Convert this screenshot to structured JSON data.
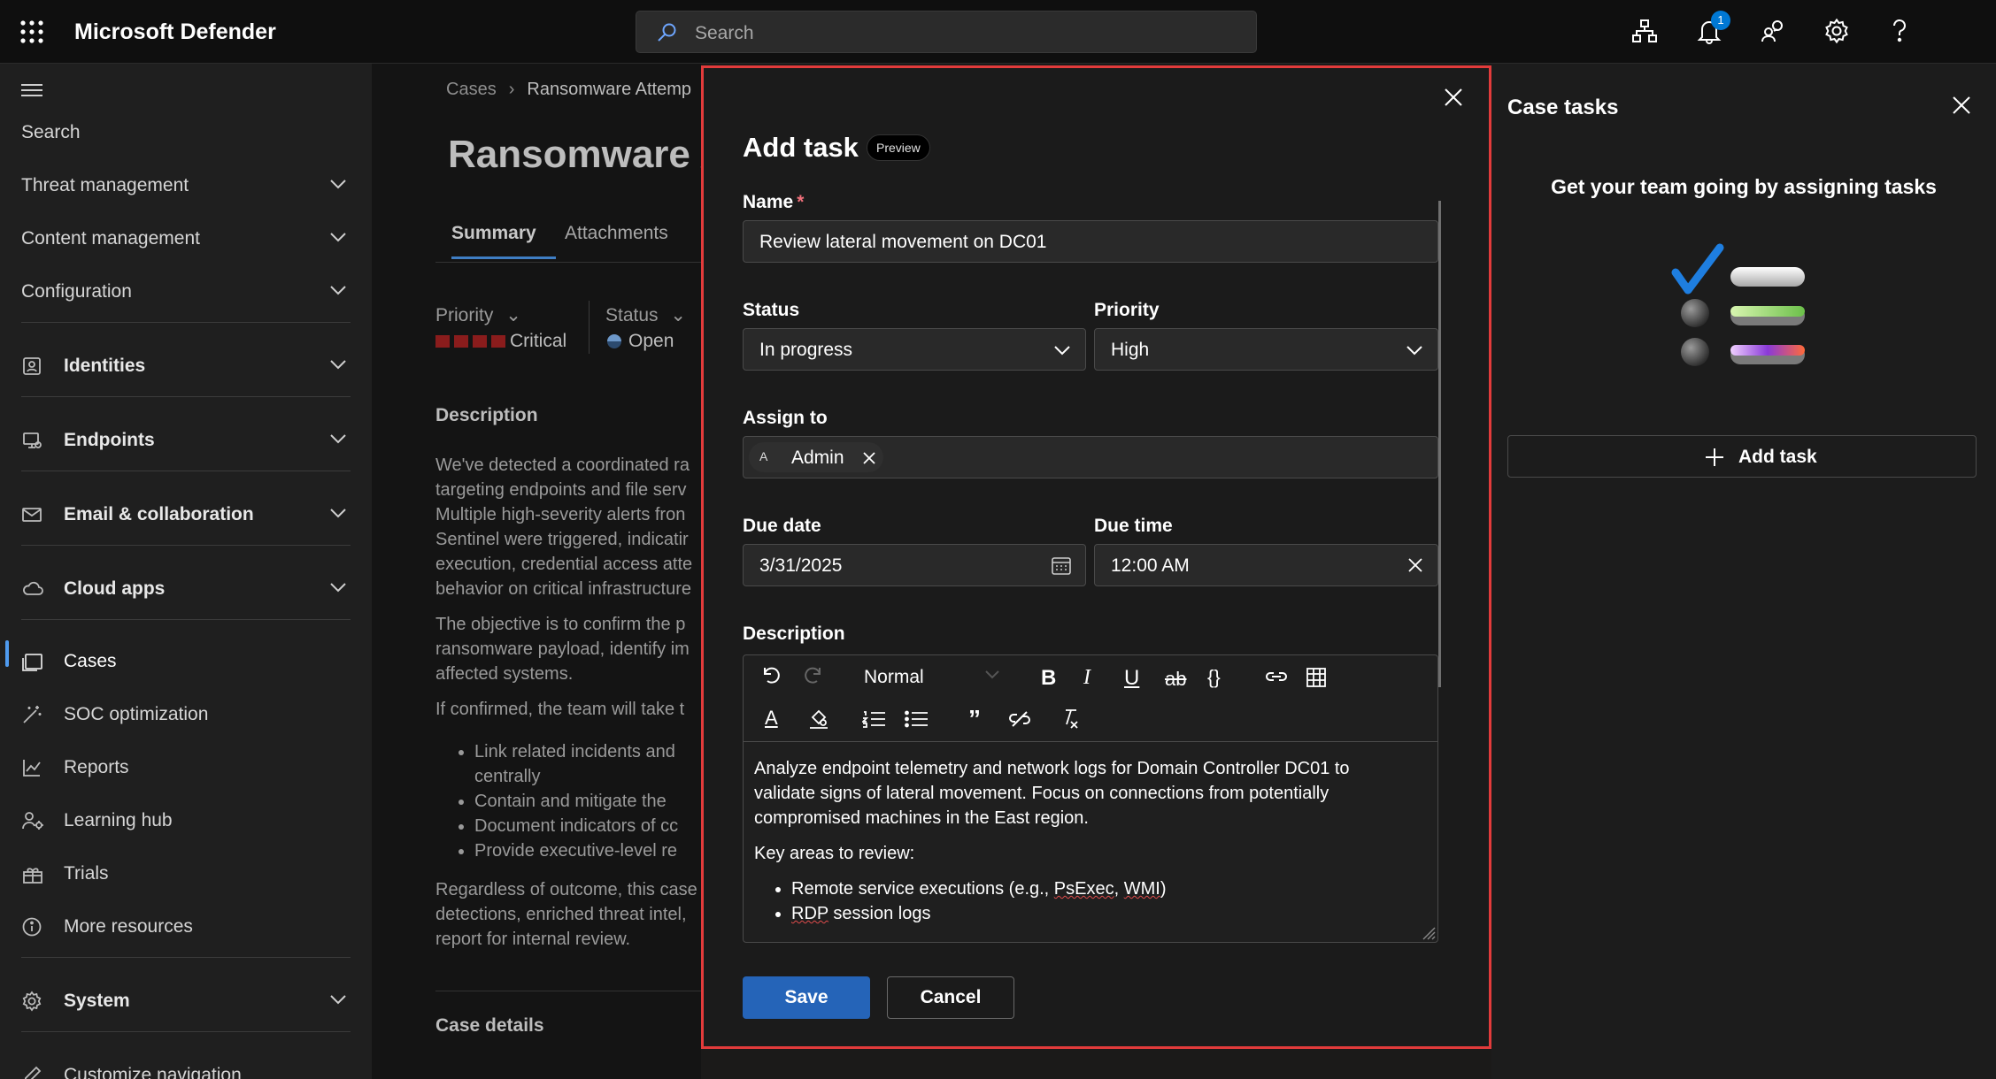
{
  "app": {
    "title": "Microsoft Defender"
  },
  "topbar": {
    "search_placeholder": "Search",
    "notification_count": "1"
  },
  "leftnav": {
    "search_label": "Search",
    "groups": [
      {
        "label": "Threat management"
      },
      {
        "label": "Content management"
      },
      {
        "label": "Configuration"
      }
    ],
    "sections": [
      {
        "label": "Identities",
        "icon": "identity-icon"
      },
      {
        "label": "Endpoints",
        "icon": "endpoint-icon"
      },
      {
        "label": "Email & collaboration",
        "icon": "mail-icon"
      },
      {
        "label": "Cloud apps",
        "icon": "cloud-icon"
      }
    ],
    "items": [
      {
        "label": "Cases",
        "icon": "cases-icon",
        "active": true
      },
      {
        "label": "SOC optimization",
        "icon": "soc-icon"
      },
      {
        "label": "Reports",
        "icon": "reports-icon"
      },
      {
        "label": "Learning hub",
        "icon": "learning-icon"
      },
      {
        "label": "Trials",
        "icon": "trials-icon"
      },
      {
        "label": "More resources",
        "icon": "info-icon"
      }
    ],
    "system": "System",
    "customize": "Customize navigation"
  },
  "page": {
    "breadcrumb_root": "Cases",
    "breadcrumb_current": "Ransomware Attemp",
    "title": "Ransomware A",
    "tabs": [
      "Summary",
      "Attachments"
    ],
    "priority_label": "Priority",
    "priority_value": "Critical",
    "status_label": "Status",
    "status_value": "Open",
    "description_title": "Description",
    "para1": [
      "We've detected a coordinated ra",
      "targeting endpoints and file serv",
      "Multiple high-severity alerts fron",
      "Sentinel were triggered, indicatir",
      "execution, credential access atte",
      "behavior on critical infrastructure"
    ],
    "para2": [
      "The objective is to confirm the p",
      "ransomware payload, identify im",
      "affected systems."
    ],
    "para3": "If confirmed, the team will take t",
    "bullets": [
      "Link related incidents and",
      "centrally",
      "Contain and mitigate the",
      "Document indicators of cc",
      "Provide executive-level re"
    ],
    "para4": [
      "Regardless of outcome, this case",
      "detections, enriched threat intel,",
      "report for internal review."
    ],
    "case_details": "Case details"
  },
  "modal": {
    "title": "Add task",
    "preview_tag": "Preview",
    "name_label": "Name",
    "name_required": "*",
    "name_value": "Review lateral movement on DC01",
    "status_label": "Status",
    "status_value": "In progress",
    "priority_label": "Priority",
    "priority_value": "High",
    "assign_label": "Assign to",
    "assignee_initial": "A",
    "assignee_name": "Admin",
    "due_date_label": "Due date",
    "due_date_value": "3/31/2025",
    "due_time_label": "Due time",
    "due_time_value": "12:00 AM",
    "description_label": "Description",
    "format_style": "Normal",
    "description_p1": [
      "Analyze endpoint telemetry and network logs for Domain Controller DC01 to",
      "validate signs of lateral movement. Focus on connections from potentially",
      "compromised machines in the East region."
    ],
    "description_p2": "Key areas to review:",
    "description_bullet1_prefix": "Remote service executions (e.g., ",
    "description_bullet1_w1": "PsExec",
    "description_bullet1_sep": ", ",
    "description_bullet1_w2": "WMI",
    "description_bullet1_suffix": ")",
    "description_bullet2_w": "RDP",
    "description_bullet2_rest": " session logs",
    "save_label": "Save",
    "cancel_label": "Cancel"
  },
  "rightpanel": {
    "title": "Case tasks",
    "empty_message": "Get your team going by assigning tasks",
    "add_task_label": "Add task"
  },
  "colors": {
    "accent": "#2564b8",
    "highlight_border": "#e23b3b",
    "critical": "#8a1c1c",
    "badge": "#0078d4"
  }
}
